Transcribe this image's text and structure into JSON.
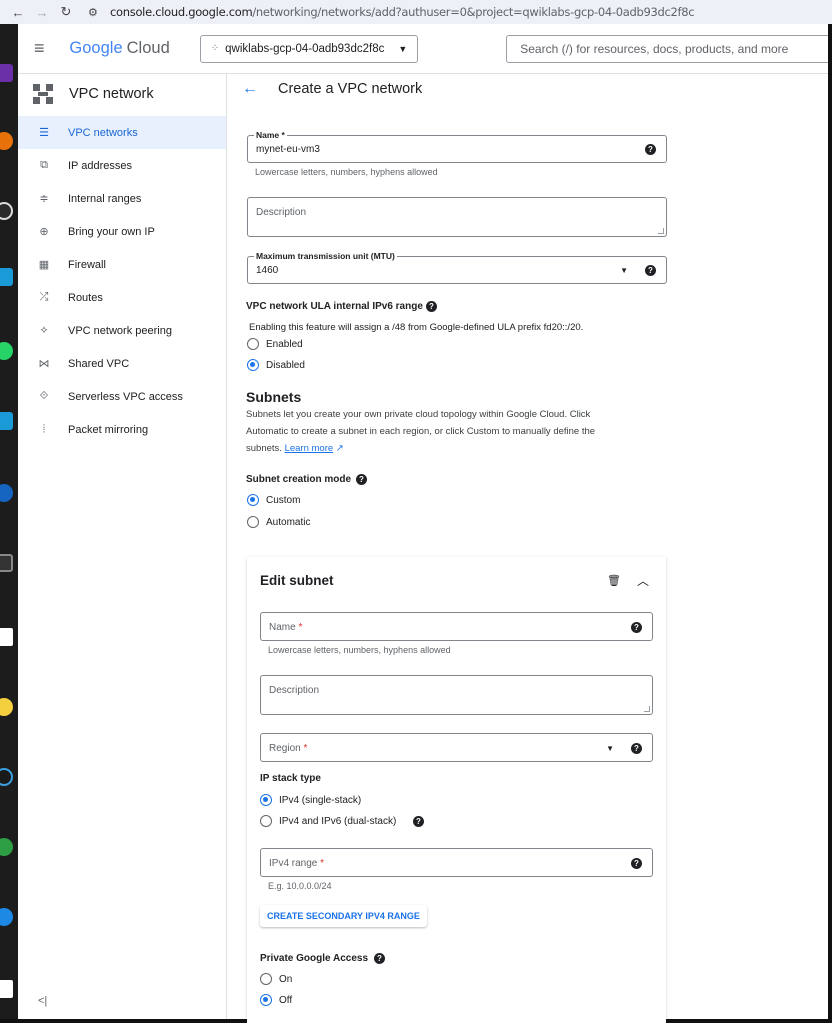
{
  "browser": {
    "url_host": "console.cloud.google.com",
    "url_path": "/networking/networks/add?authuser=0&project=qwiklabs-gcp-04-0adb93dc2f8c"
  },
  "header": {
    "logo_google": "Google",
    "logo_cloud": "Cloud",
    "project_name": "qwiklabs-gcp-04-0adb93dc2f8c",
    "search_placeholder": "Search (/) for resources, docs, products, and more"
  },
  "sidebar": {
    "title": "VPC network",
    "items": [
      {
        "label": "VPC networks",
        "icon": "vpc-networks-icon",
        "active": true
      },
      {
        "label": "IP addresses",
        "icon": "ip-addresses-icon"
      },
      {
        "label": "Internal ranges",
        "icon": "internal-ranges-icon"
      },
      {
        "label": "Bring your own IP",
        "icon": "globe-icon"
      },
      {
        "label": "Firewall",
        "icon": "firewall-icon"
      },
      {
        "label": "Routes",
        "icon": "routes-icon"
      },
      {
        "label": "VPC network peering",
        "icon": "peering-icon"
      },
      {
        "label": "Shared VPC",
        "icon": "shared-vpc-icon"
      },
      {
        "label": "Serverless VPC access",
        "icon": "serverless-icon"
      },
      {
        "label": "Packet mirroring",
        "icon": "packet-mirroring-icon"
      }
    ]
  },
  "page": {
    "title": "Create a VPC network"
  },
  "form": {
    "name_label": "Name",
    "name_required": " *",
    "name_value": "mynet-eu-vm3",
    "name_hint": "Lowercase letters, numbers, hyphens allowed",
    "description_placeholder": "Description",
    "mtu_label": "Maximum transmission unit (MTU)",
    "mtu_value": "1460",
    "ula_label": "VPC network ULA internal IPv6 range",
    "ula_desc": "Enabling this feature will assign a /48 from Google-defined ULA prefix fd20::/20.",
    "ula_enabled": "Enabled",
    "ula_disabled": "Disabled",
    "subnets_title": "Subnets",
    "subnets_desc1": "Subnets let you create your own private cloud topology within Google Cloud. Click",
    "subnets_desc2": "Automatic to create a subnet in each region, or click Custom to manually define the",
    "subnets_desc3": "subnets.",
    "learn_more": "Learn more",
    "mode_label": "Subnet creation mode",
    "mode_custom": "Custom",
    "mode_automatic": "Automatic"
  },
  "subnet": {
    "title": "Edit subnet",
    "name_placeholder": "Name",
    "required": " *",
    "name_hint": "Lowercase letters, numbers, hyphens allowed",
    "description_placeholder": "Description",
    "region_placeholder": "Region",
    "ip_stack_label": "IP stack type",
    "ipv4_single": "IPv4 (single-stack)",
    "ipv4_dual": "IPv4 and IPv6 (dual-stack)",
    "ipv4_range_placeholder": "IPv4 range",
    "ipv4_range_hint": "E.g. 10.0.0.0/24",
    "secondary_button": "CREATE SECONDARY IPV4 RANGE",
    "private_access_label": "Private Google Access",
    "on": "On",
    "off": "Off"
  }
}
